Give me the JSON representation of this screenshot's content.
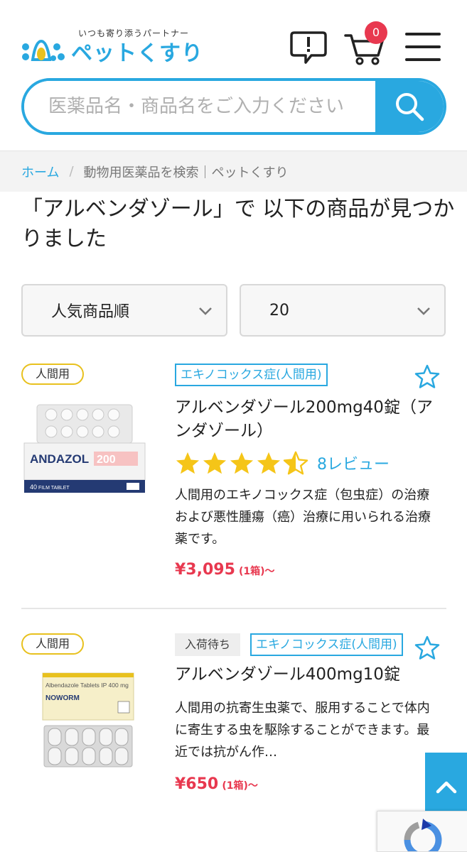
{
  "header": {
    "tagline": "いつも寄り添うパートナー",
    "site_name": "ペットくすり",
    "cart_count": "0",
    "brand_color": "#29a8e0"
  },
  "search": {
    "placeholder": "医薬品名・商品名をご入力ください"
  },
  "breadcrumb": {
    "home": "ホーム",
    "separator": "/",
    "current": "動物用医薬品を検索｜ペットくすり"
  },
  "results": {
    "heading": "「アルベンダゾール」で 以下の商品が見つかりました"
  },
  "filters": {
    "sort_selected": "人気商品順",
    "count_selected": "20"
  },
  "products": [
    {
      "badge": "人間用",
      "category_tag": "エキノコックス症(人間用)",
      "name": "アルベンダゾール200mg40錠（アンダゾール）",
      "rating": 4.5,
      "reviews": "8レビュー",
      "description": "人間用のエキノコックス症（包虫症）の治療および悪性腫瘍（癌）治療に用いられる治療薬です。",
      "price": "¥3,095",
      "price_unit": "(1箱)〜",
      "image_brand": "ANDAZOL",
      "image_strength": "200",
      "image_count": "40"
    },
    {
      "badge": "人間用",
      "stock_tag": "入荷待ち",
      "category_tag": "エキノコックス症(人間用)",
      "name": "アルベンダゾール400mg10錠",
      "description": "人間用の抗寄生虫薬で、服用することで体内に寄生する虫を駆除することができます。最近では抗がん作…",
      "price": "¥650",
      "price_unit": "(1箱)〜",
      "image_title": "Albendazole Tablets IP 400 mg",
      "image_brand": "NOWORM"
    }
  ],
  "colors": {
    "accent": "#29a8e0",
    "price": "#e8384f",
    "star": "#f5c518",
    "badge_border": "#e8c11e"
  }
}
